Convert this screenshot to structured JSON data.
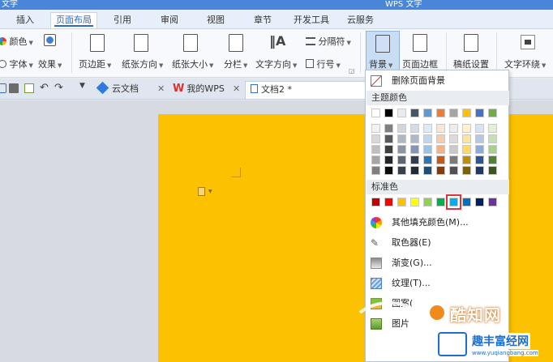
{
  "window": {
    "title_left": "文字",
    "title_doc": "WPS 文字"
  },
  "ribbon_tabs": [
    {
      "label": "插入"
    },
    {
      "label": "页面布局"
    },
    {
      "label": "引用"
    },
    {
      "label": "审阅"
    },
    {
      "label": "视图"
    },
    {
      "label": "章节"
    },
    {
      "label": "开发工具"
    },
    {
      "label": "云服务"
    }
  ],
  "ribbon": {
    "colors": "颜色",
    "font": "字体",
    "effects": "效果",
    "margins": "页边距",
    "orientation": "纸张方向",
    "size": "纸张大小",
    "columns": "分栏",
    "text_direction": "文字方向",
    "breaks": "分隔符",
    "line_numbers": "行号",
    "background": "背景",
    "page_border": "页面边框",
    "draft": "稿纸设置",
    "text_wrap": "文字环绕"
  },
  "doc_tabs": [
    {
      "label": "云文档"
    },
    {
      "label": "我的WPS"
    },
    {
      "label": "文档2 *"
    }
  ],
  "menu": {
    "remove_bg": "删除页面背景",
    "theme_colors_head": "主题颜色",
    "standard_colors_head": "标准色",
    "more_colors": "其他填充颜色(M)...",
    "eyedropper": "取色器(E)",
    "gradient": "渐变(G)...",
    "texture": "纹理(T)...",
    "pattern": "图案(",
    "picture": "图片"
  },
  "theme_top_row": [
    "#ffffff",
    "#000000",
    "#e8ecef",
    "#44546a",
    "#5b9bd5",
    "#ed7d31",
    "#a5a5a5",
    "#ffc000",
    "#4472c4",
    "#70ad47"
  ],
  "theme_shades": [
    [
      "#f2f2f2",
      "#7f7f7f",
      "#d0d6dc",
      "#d6dce4",
      "#deebf6",
      "#fbe5d5",
      "#ededed",
      "#fff2cc",
      "#dae3f3",
      "#e2efd9"
    ],
    [
      "#d8d8d8",
      "#595959",
      "#aeb8c1",
      "#adb9ca",
      "#bdd7ee",
      "#f7cbac",
      "#dbdbdb",
      "#fee599",
      "#b4c7e7",
      "#c5e0b3"
    ],
    [
      "#bfbfbf",
      "#3f3f3f",
      "#8b96a0",
      "#8496b0",
      "#9cc3e5",
      "#f4b183",
      "#c9c9c9",
      "#ffd965",
      "#8eaadb",
      "#a8d08d"
    ],
    [
      "#a5a5a5",
      "#262626",
      "#5d6770",
      "#323e4f",
      "#2e75b5",
      "#c55a11",
      "#7b7b7b",
      "#bf9000",
      "#2f5496",
      "#538135"
    ],
    [
      "#7f7f7f",
      "#0c0c0c",
      "#394048",
      "#222a35",
      "#1f4e79",
      "#833c0b",
      "#525252",
      "#7f6000",
      "#1f3864",
      "#375623"
    ]
  ],
  "standard_colors": [
    "#c00000",
    "#ff0000",
    "#ffc000",
    "#ffff00",
    "#92d050",
    "#00b050",
    "#00b0f0",
    "#0070c0",
    "#002060",
    "#7030a0"
  ],
  "selected_standard_index": 6,
  "page_color": "#fcc100",
  "watermark": {
    "brand": "酷知网",
    "sub": "趣丰富经网",
    "url": "www.yuqiangbang.com"
  }
}
